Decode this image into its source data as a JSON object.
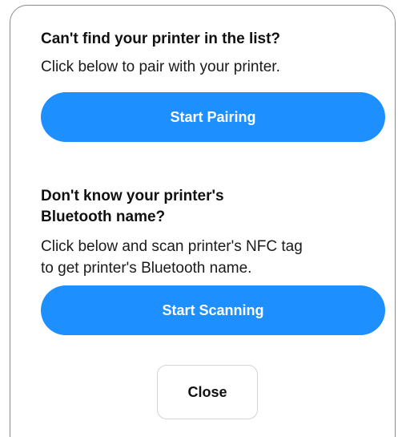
{
  "pairing": {
    "heading": "Can't find your printer in the list?",
    "description": "Click below to pair with your printer.",
    "button_label": "Start Pairing"
  },
  "scanning": {
    "heading_line1": "Don't know your printer's",
    "heading_line2": "Bluetooth name?",
    "description_line1": "Click below and scan printer's NFC tag",
    "description_line2": "to get printer's Bluetooth name.",
    "button_label": "Start Scanning"
  },
  "close_label": "Close",
  "colors": {
    "accent": "#1e8fff",
    "border": "#8a8a8a"
  }
}
